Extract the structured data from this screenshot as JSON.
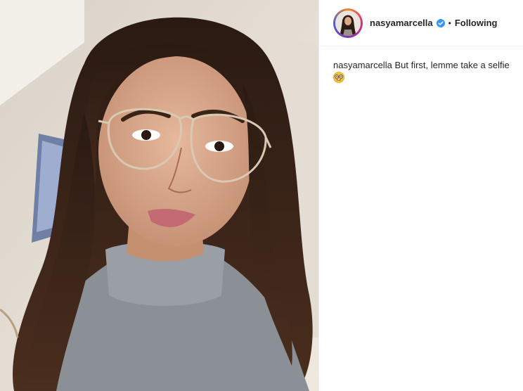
{
  "post": {
    "photo_alt": "selfie photo",
    "author": {
      "username": "nasyamarcella",
      "verified": true,
      "follow_status": "Following",
      "separator": "•"
    },
    "caption": {
      "username": "nasyamarcella",
      "text": "But first, lemme take a selfie",
      "emoji": "nerd-face-emoji"
    }
  },
  "colors": {
    "verified_blue": "#3897f0",
    "text": "#262626",
    "border": "#efefef"
  }
}
